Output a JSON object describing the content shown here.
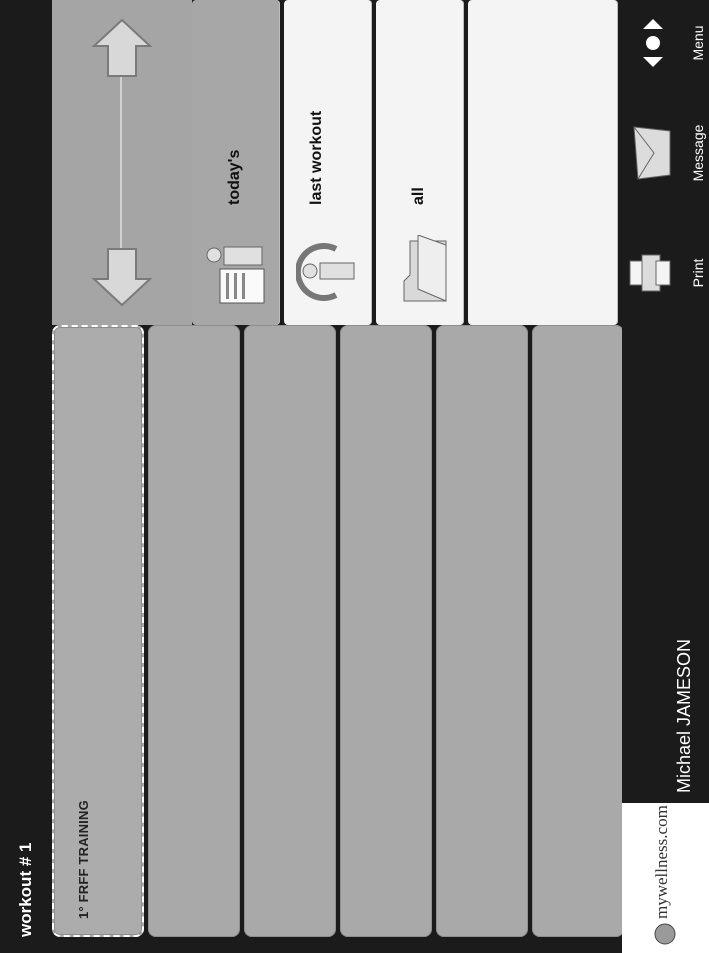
{
  "header": {
    "title": "workout # 1"
  },
  "slots": [
    {
      "label": "1°   FRFF TRAINING",
      "selected": true
    },
    {
      "label": ""
    },
    {
      "label": ""
    },
    {
      "label": ""
    },
    {
      "label": ""
    },
    {
      "label": ""
    }
  ],
  "tabs": [
    {
      "label": "today's",
      "icon": "clipboard-person-icon",
      "active": true
    },
    {
      "label": "last workout",
      "icon": "person-history-icon",
      "active": false
    },
    {
      "label": "all",
      "icon": "folder-icon",
      "active": false
    }
  ],
  "toolbar": {
    "brand": "mywellness.com",
    "user": "Michael JAMESON",
    "print_label": "Print",
    "message_label": "Message",
    "menu_label": "Menu"
  }
}
